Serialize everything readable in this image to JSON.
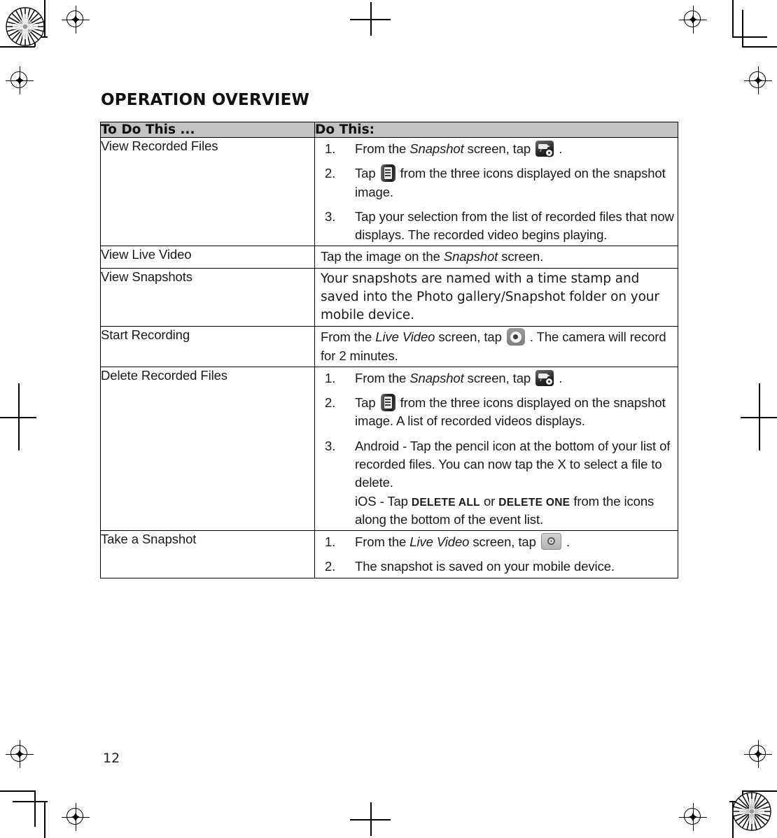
{
  "page": {
    "title": "OPERATION OVERVIEW",
    "page_number": "12"
  },
  "table": {
    "headers": {
      "col1": "To Do This ...",
      "col2": "Do This:"
    },
    "rows": [
      {
        "label": "View Recorded Files",
        "steps": [
          {
            "pre": "From the ",
            "italic": "Snapshot",
            "post": " screen, tap ",
            "icon": "camcorder-settings-icon",
            "tail": " ."
          },
          {
            "pre": "Tap ",
            "italic": "",
            "post": " from the three icons displayed on the snapshot image.",
            "icon": "list-icon",
            "tail": ""
          },
          {
            "pre": "Tap your selection from the list of recorded files that now displays. The recorded video begins playing.",
            "italic": "",
            "post": "",
            "icon": "",
            "tail": ""
          }
        ]
      },
      {
        "label": "View Live Video",
        "plain": {
          "pre": "Tap the image on the ",
          "italic": "Snapshot",
          "post": " screen."
        }
      },
      {
        "label": "View Snapshots",
        "alt_font": true,
        "plain_text": "Your snapshots are named with a time stamp and saved into the Photo gallery/Snapshot folder on your mobile device."
      },
      {
        "label": "Start Recording",
        "plain": {
          "pre": "From the ",
          "italic": "Live Video",
          "post": " screen, tap ",
          "icon": "record-icon",
          "tail": " . The camera will record for 2 minutes."
        }
      },
      {
        "label": "Delete Recorded Files",
        "steps": [
          {
            "pre": "From the ",
            "italic": "Snapshot",
            "post": " screen, tap ",
            "icon": "camcorder-settings-icon",
            "tail": " ."
          },
          {
            "pre": "Tap ",
            "italic": "",
            "post": " from the three icons displayed on the snapshot image. A list of recorded videos displays.",
            "icon": "list-icon",
            "tail": ""
          },
          {
            "pre": "Android - Tap the pencil icon at the bottom of your list of recorded files. You can now tap the X to select a file to delete.",
            "sub_pre": "iOS - Tap ",
            "sub_caps1": "DELETE ALL",
            "sub_mid": " or ",
            "sub_caps2": "DELETE ONE",
            "sub_post": " from the icons along the bottom of the event list.",
            "italic": "",
            "post": "",
            "icon": "",
            "tail": ""
          }
        ]
      },
      {
        "label": "Take a Snapshot",
        "steps": [
          {
            "pre": "From the ",
            "italic": "Live Video",
            "post": " screen, tap ",
            "icon": "camera-icon",
            "tail": " ."
          },
          {
            "pre": "The snapshot is saved on your mobile device.",
            "italic": "",
            "post": "",
            "icon": "",
            "tail": ""
          }
        ]
      }
    ]
  },
  "colors": {
    "header_background": "#c3c3c3",
    "border": "#000000",
    "text": "#1a1a1a"
  }
}
